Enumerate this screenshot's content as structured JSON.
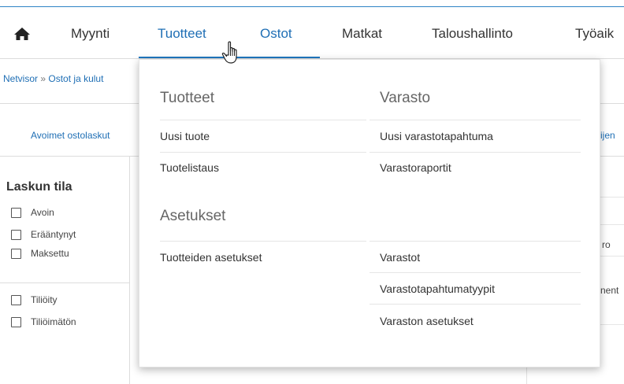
{
  "nav": {
    "home_icon": "home-icon",
    "items": [
      "Myynti",
      "Tuotteet",
      "Ostot",
      "Matkat",
      "Taloushallinto",
      "Työaik"
    ],
    "active_color": "#1f6fb5"
  },
  "breadcrumb": {
    "root": "Netvisor",
    "separator": "»",
    "current": "Ostot ja kulut"
  },
  "subnav": {
    "left": "Avoimet ostolaskut",
    "right": "ijen"
  },
  "filters": {
    "title": "Laskun tila",
    "status": [
      "Avoin",
      "Erääntynyt",
      "Maksettu"
    ],
    "accounting": [
      "Tiliöity",
      "Tiliöimätön"
    ]
  },
  "right_column": {
    "stub1": "ro",
    "stub2": "nent"
  },
  "dropdown": {
    "tuotteet": {
      "heading": "Tuotteet",
      "items": [
        "Uusi tuote",
        "Tuotelistaus"
      ]
    },
    "varasto": {
      "heading": "Varasto",
      "items": [
        "Uusi varastotapahtuma",
        "Varastoraportit"
      ]
    },
    "asetukset": {
      "heading": "Asetukset",
      "items": [
        "Tuotteiden asetukset"
      ]
    },
    "varasto_settings": {
      "items": [
        "Varastot",
        "Varastotapahtumatyypit",
        "Varaston asetukset"
      ]
    }
  }
}
